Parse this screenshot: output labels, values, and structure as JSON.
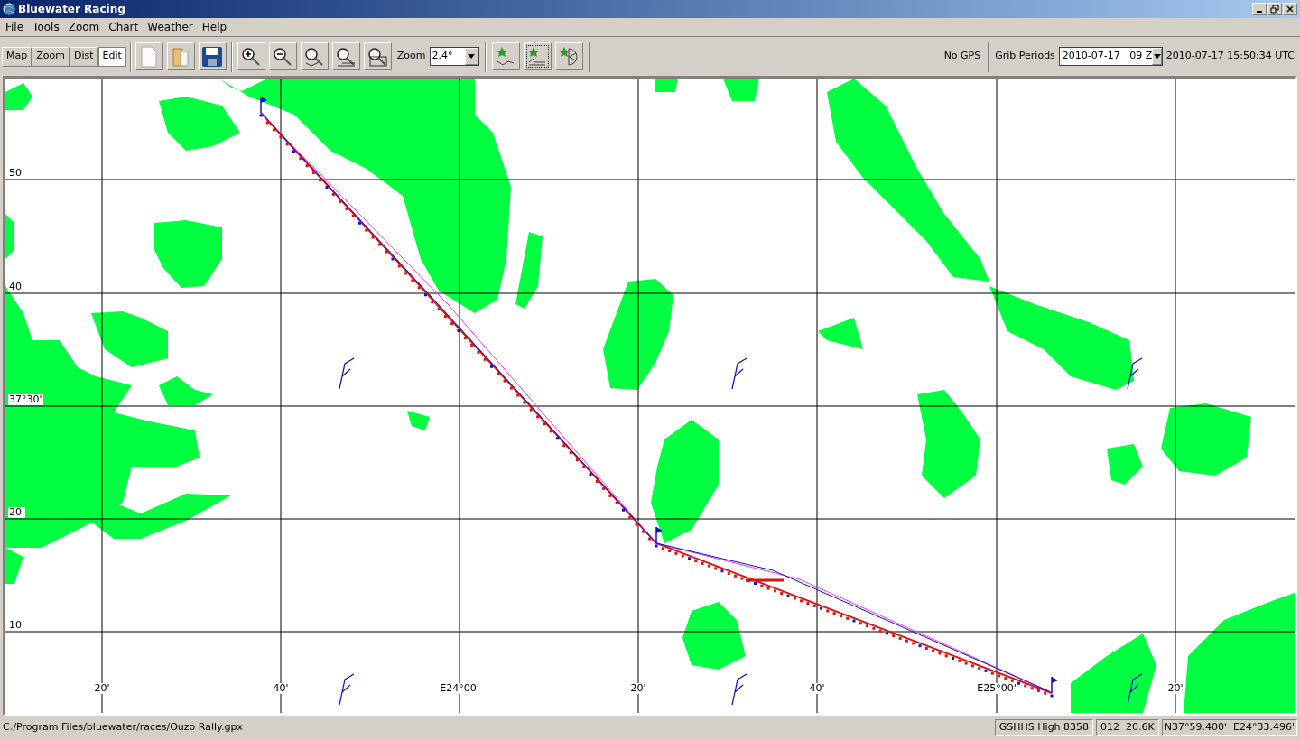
{
  "window": {
    "title": "Bluewater Racing"
  },
  "menu": [
    "File",
    "Tools",
    "Zoom",
    "Chart",
    "Weather",
    "Help"
  ],
  "modes": [
    {
      "label": "Map",
      "selected": false
    },
    {
      "label": "Zoom",
      "selected": false
    },
    {
      "label": "Dist",
      "selected": false
    },
    {
      "label": "Edit",
      "selected": true
    }
  ],
  "zoom": {
    "label": "Zoom",
    "value": "2.4°"
  },
  "route_tools": [
    {
      "kind": "route",
      "selected": false
    },
    {
      "kind": "track",
      "selected": true
    },
    {
      "kind": "polar",
      "selected": false
    }
  ],
  "gps": "No GPS",
  "grib": {
    "label": "Grib Periods",
    "value": "2010-07-17   09 Z"
  },
  "clock": "2010-07-17 15:50:34 UTC",
  "chart": {
    "lat_labels": [
      "50'",
      "40'",
      "37°30'",
      "20'",
      "10'"
    ],
    "lon_labels": [
      "20'",
      "40'",
      "E24°00'",
      "20'",
      "40'",
      "E25°00'",
      "20'"
    ]
  },
  "status_bar": {
    "file": "C:/Program Files/bluewater/races/Ouzo Rally.gpx",
    "coastline": "GSHHS High 8358",
    "zoom_info": "012  20.6K",
    "position": "N37°59.400'  E24°33.496'"
  }
}
